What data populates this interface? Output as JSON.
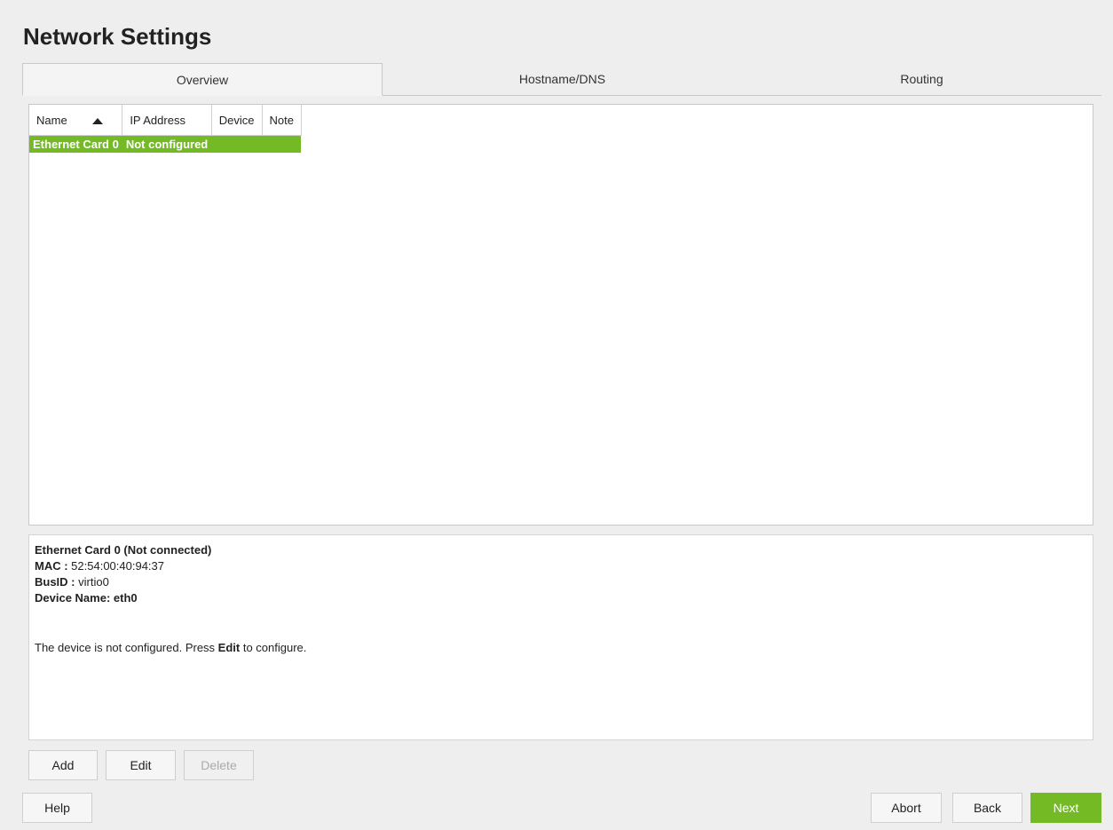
{
  "title": "Network Settings",
  "tabs": [
    {
      "label": "Overview",
      "active": true
    },
    {
      "label": "Hostname/DNS",
      "active": false
    },
    {
      "label": "Routing",
      "active": false
    }
  ],
  "table": {
    "columns": [
      "Name",
      "IP Address",
      "Device",
      "Note"
    ],
    "sort_column": "Name",
    "rows": [
      {
        "name": "Ethernet Card 0",
        "ip": "Not configured",
        "device": "",
        "note": "",
        "selected": true
      }
    ]
  },
  "details": {
    "heading": "Ethernet Card 0 (Not connected)",
    "mac_label": "MAC :",
    "mac_value": "52:54:00:40:94:37",
    "busid_label": "BusID :",
    "busid_value": "virtio0",
    "device_name": "Device Name: eth0",
    "note_prefix": "The device is not configured. Press ",
    "note_bold": "Edit",
    "note_suffix": " to configure."
  },
  "buttons": {
    "add": "Add",
    "edit": "Edit",
    "delete": "Delete",
    "help": "Help",
    "abort": "Abort",
    "back": "Back",
    "next": "Next"
  },
  "colors": {
    "accent": "#73ba25"
  }
}
